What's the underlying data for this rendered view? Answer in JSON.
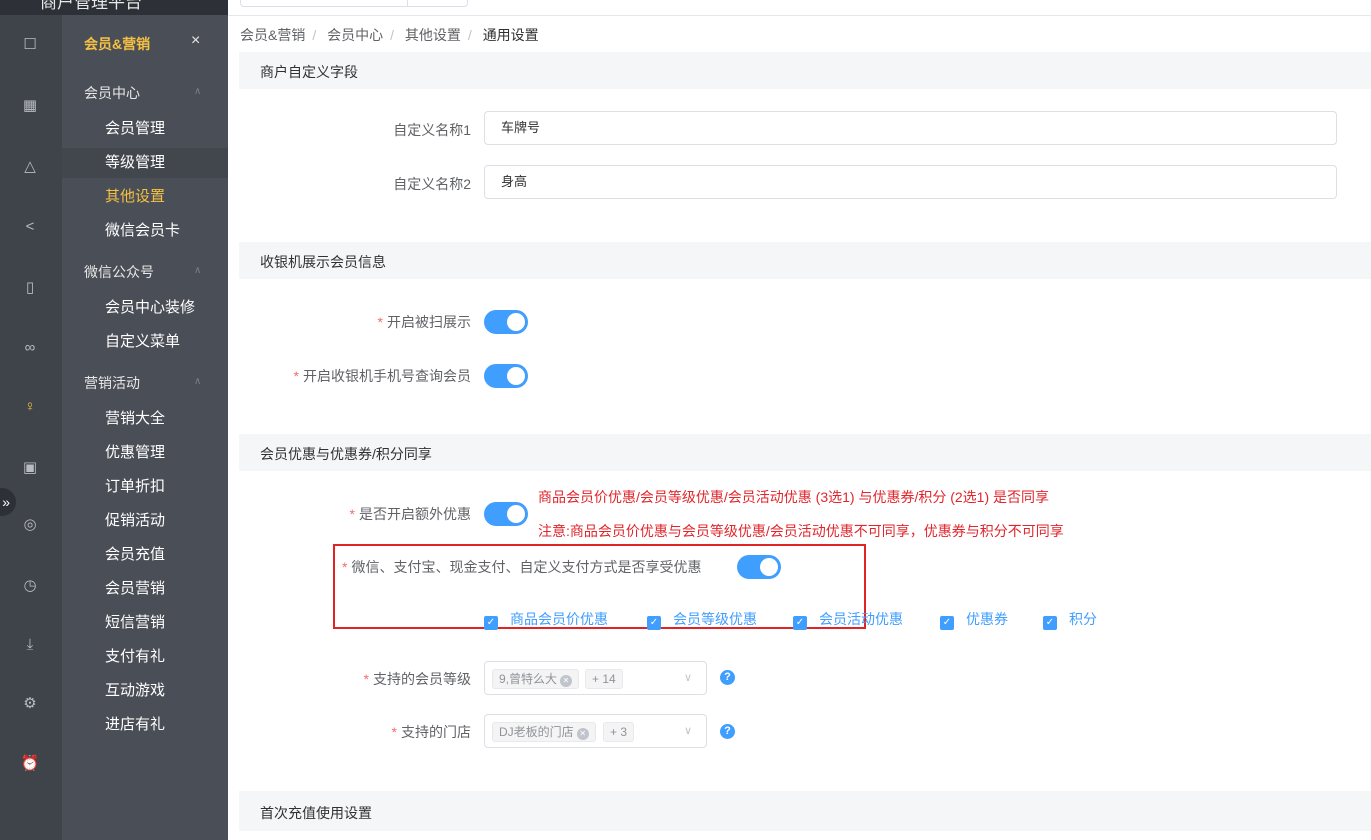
{
  "brand": {
    "title": "商户管理平台"
  },
  "rail": {
    "icons": [
      "dashboard-icon",
      "calendar-icon",
      "bag-icon",
      "share-icon",
      "tablet-icon",
      "bike-icon",
      "user-icon",
      "truck-icon",
      "database-icon",
      "clock-icon",
      "download-icon",
      "settings-icon",
      "alarm-icon"
    ],
    "active": "user-icon"
  },
  "submenu": {
    "title": "会员&营销",
    "close": "×",
    "groups": [
      {
        "label": "会员中心",
        "items": [
          "会员管理",
          "等级管理",
          "其他设置",
          "微信会员卡"
        ]
      },
      {
        "label": "微信公众号",
        "items": [
          "会员中心装修",
          "自定义菜单"
        ]
      },
      {
        "label": "营销活动",
        "items": [
          "营销大全",
          "优惠管理",
          "订单折扣",
          "促销活动",
          "会员充值",
          "会员营销",
          "短信营销",
          "支付有礼",
          "互动游戏",
          "进店有礼"
        ]
      }
    ],
    "active_item": "其他设置",
    "highlight_item": "等级管理"
  },
  "breadcrumb": [
    "会员&营销",
    "会员中心",
    "其他设置",
    "通用设置"
  ],
  "sections": {
    "custom_fields": {
      "title": "商户自定义字段",
      "field1": {
        "label": "自定义名称1",
        "value": "车牌号"
      },
      "field2": {
        "label": "自定义名称2",
        "value": "身高"
      }
    },
    "cashier": {
      "title": "收银机展示会员信息",
      "scan_display": {
        "label": "开启被扫展示",
        "on": true
      },
      "phone_query": {
        "label": "开启收银机手机号查询会员",
        "on": true
      }
    },
    "discount": {
      "title": "会员优惠与优惠券/积分同享",
      "extra": {
        "label": "是否开启额外优惠",
        "on": true
      },
      "note1": "商品会员价优惠/会员等级优惠/会员活动优惠 (3选1) 与优惠券/积分 (2选1) 是否同享",
      "note2": "注意:商品会员价优惠与会员等级优惠/会员活动优惠不可同享，优惠券与积分不可同享",
      "payment": {
        "label": "微信、支付宝、现金支付、自定义支付方式是否享受优惠",
        "on": true
      },
      "checkboxes": [
        "商品会员价优惠",
        "会员等级优惠",
        "会员活动优惠",
        "优惠券",
        "积分"
      ],
      "levels": {
        "label": "支持的会员等级",
        "tag": "9,曾特么大",
        "more": "+ 14"
      },
      "stores": {
        "label": "支持的门店",
        "tag": "DJ老板的门店",
        "more": "+ 3"
      }
    },
    "first_recharge": {
      "title": "首次充值使用设置"
    }
  },
  "required_mark": "*",
  "colors": {
    "accent": "#409eff",
    "active_menu": "#f5c143",
    "warning_text": "#e0262c"
  }
}
